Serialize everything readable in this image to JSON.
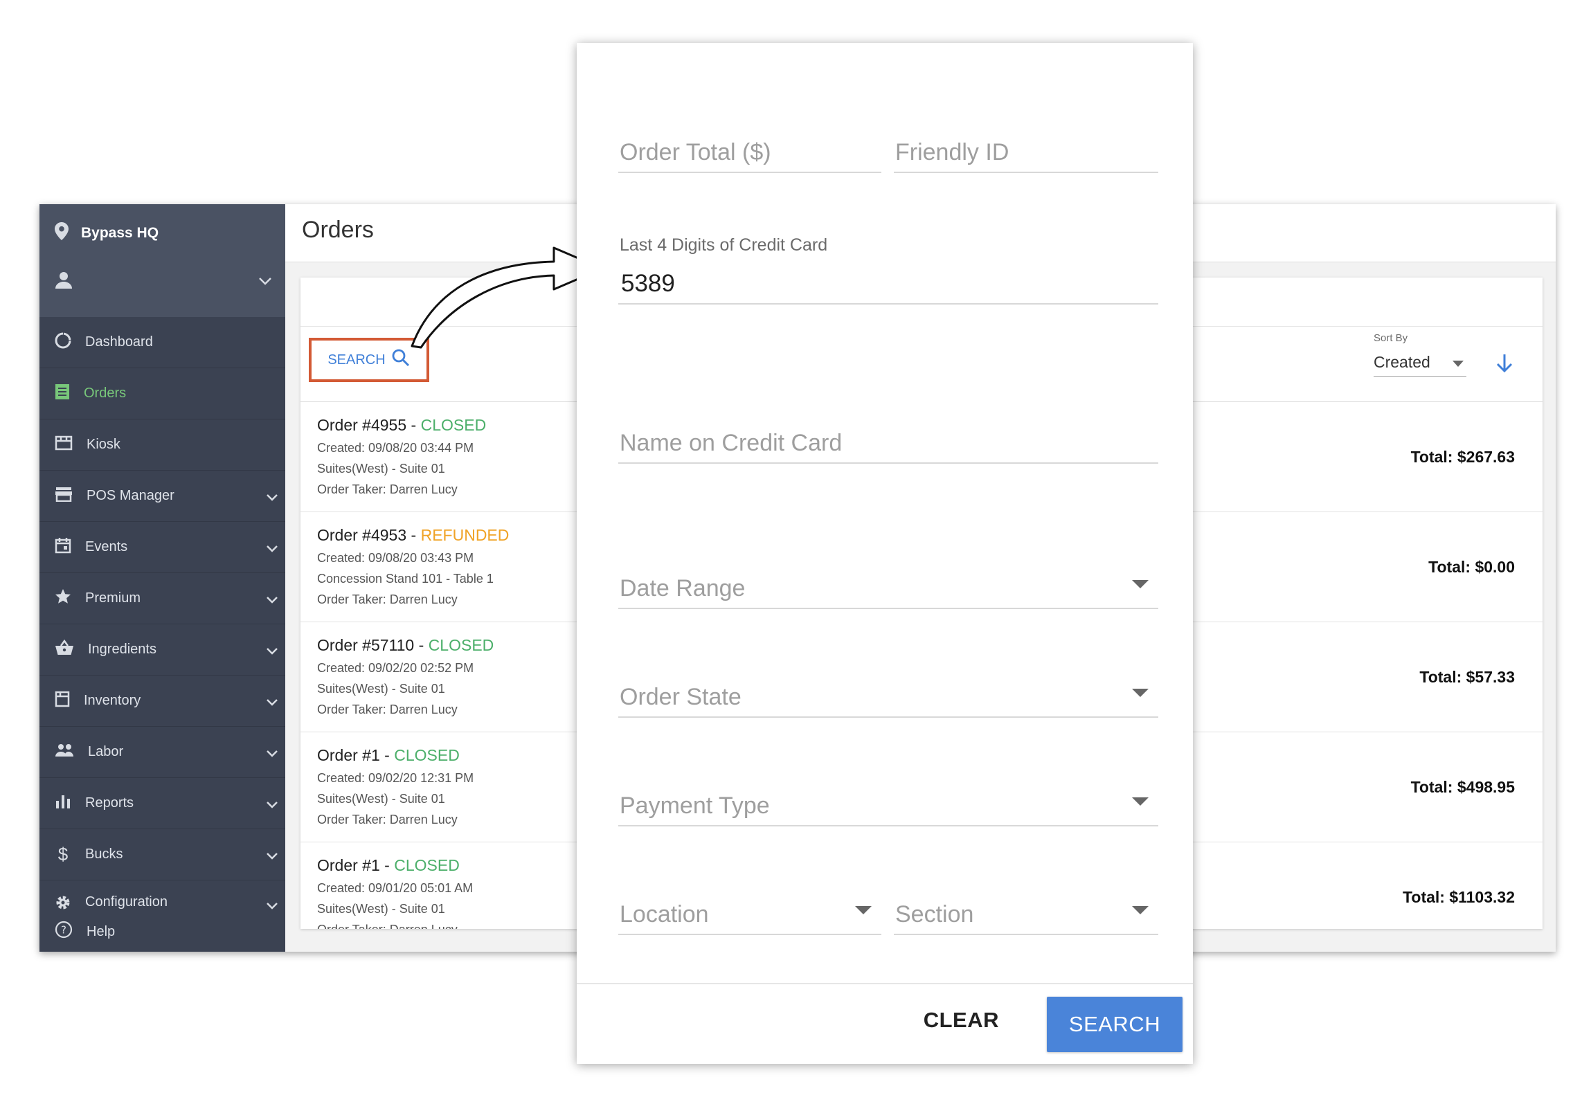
{
  "sidebar": {
    "venue": "Bypass HQ",
    "items": [
      {
        "label": "Dashboard",
        "icon": "dashboard-icon",
        "active": false
      },
      {
        "label": "Orders",
        "icon": "orders-icon",
        "active": true
      },
      {
        "label": "Kiosk",
        "icon": "kiosk-icon",
        "active": false
      },
      {
        "label": "POS Manager",
        "icon": "store-icon",
        "active": false
      },
      {
        "label": "Events",
        "icon": "calendar-icon",
        "active": false
      },
      {
        "label": "Premium",
        "icon": "star-icon",
        "active": false
      },
      {
        "label": "Ingredients",
        "icon": "basket-icon",
        "active": false
      },
      {
        "label": "Inventory",
        "icon": "inventory-icon",
        "active": false
      },
      {
        "label": "Labor",
        "icon": "people-icon",
        "active": false
      },
      {
        "label": "Reports",
        "icon": "bar-chart-icon",
        "active": false
      },
      {
        "label": "Bucks",
        "icon": "dollar-icon",
        "active": false
      },
      {
        "label": "Configuration",
        "icon": "gear-icon",
        "active": false
      }
    ],
    "help": "Help"
  },
  "header": {
    "title": "Orders"
  },
  "toolbar": {
    "search_label": "SEARCH",
    "sort_label": "Sort By",
    "sort_value": "Created"
  },
  "orders": [
    {
      "id": "Order #4955",
      "status": "CLOSED",
      "created": "Created: 09/08/20 03:44 PM",
      "location": "Suites(West) - Suite 01",
      "taker": "Order Taker: Darren Lucy",
      "total": "Total: $267.63"
    },
    {
      "id": "Order #4953",
      "status": "REFUNDED",
      "created": "Created: 09/08/20 03:43 PM",
      "location": "Concession Stand 101 - Table 1",
      "taker": "Order Taker: Darren Lucy",
      "total": "Total: $0.00"
    },
    {
      "id": "Order #57110",
      "status": "CLOSED",
      "created": "Created: 09/02/20 02:52 PM",
      "location": "Suites(West) - Suite 01",
      "taker": "Order Taker: Darren Lucy",
      "total": "Total: $57.33"
    },
    {
      "id": "Order #1",
      "status": "CLOSED",
      "created": "Created: 09/02/20 12:31 PM",
      "location": "Suites(West) - Suite 01",
      "taker": "Order Taker: Darren Lucy",
      "total": "Total: $498.95"
    },
    {
      "id": "Order #1",
      "status": "CLOSED",
      "created": "Created: 09/01/20 05:01 AM",
      "location": "Suites(West) - Suite 01",
      "taker": "Order Taker: Darren Lucy",
      "total": "Total: $1103.32"
    }
  ],
  "modal": {
    "order_total_placeholder": "Order Total ($)",
    "friendly_id_placeholder": "Friendly ID",
    "last4_label": "Last 4 Digits of Credit Card",
    "last4_value": "5389",
    "name_on_card_placeholder": "Name on Credit Card",
    "date_range_placeholder": "Date Range",
    "order_state_placeholder": "Order State",
    "payment_type_placeholder": "Payment Type",
    "location_placeholder": "Location",
    "section_placeholder": "Section",
    "clear_label": "CLEAR",
    "search_label": "SEARCH"
  },
  "colors": {
    "sidebar_bg": "#3b4252",
    "active_nav": "#78c77a",
    "accent_blue": "#4a84d9",
    "closed_green": "#4caf6a",
    "refunded_orange": "#f0a326",
    "highlight_box": "#d35a35"
  }
}
